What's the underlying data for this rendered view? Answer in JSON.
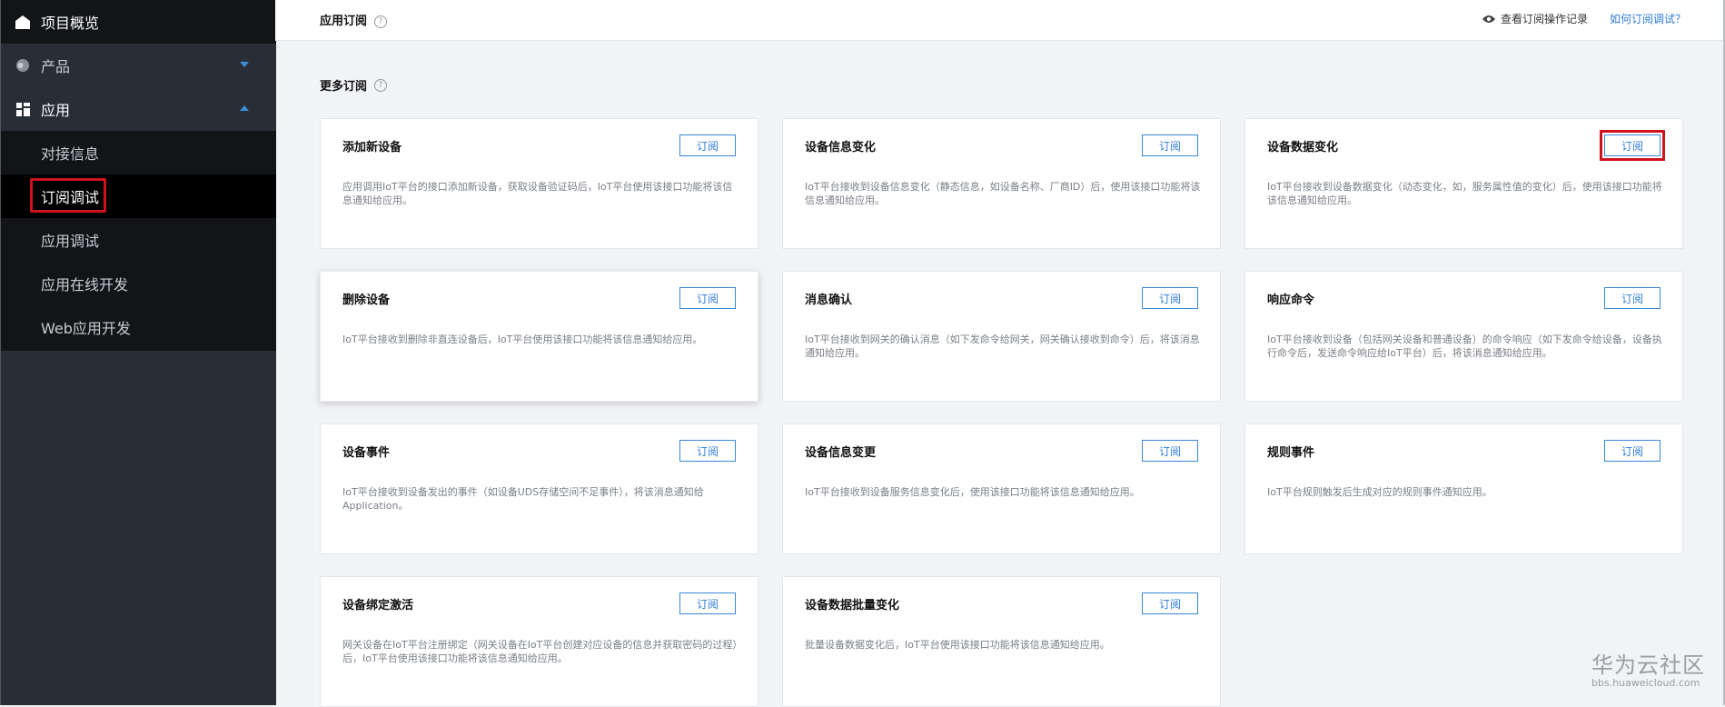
{
  "sidebar": {
    "overview": "项目概览",
    "product": "产品",
    "application": "应用",
    "app_sub_items": [
      "对接信息",
      "订阅调试",
      "应用调试",
      "应用在线开发",
      "Web应用开发"
    ]
  },
  "header": {
    "title": "应用订阅",
    "records_link": "查看订阅操作记录",
    "howto_link": "如何订阅调试？"
  },
  "section_title": "更多订阅",
  "subscribe_label": "订阅",
  "cards": [
    {
      "title": "添加新设备",
      "desc": "应用调用IoT平台的接口添加新设备，获取设备验证码后，IoT平台使用该接口功能将该信息通知给应用。"
    },
    {
      "title": "设备信息变化",
      "desc": "IoT平台接收到设备信息变化（静态信息，如设备名称、厂商ID）后，使用该接口功能将该信息通知给应用。"
    },
    {
      "title": "设备数据变化",
      "desc": "IoT平台接收到设备数据变化（动态变化，如，服务属性值的变化）后，使用该接口功能将该信息通知给应用。"
    },
    {
      "title": "删除设备",
      "desc": "IoT平台接收到删除非直连设备后，IoT平台使用该接口功能将该信息通知给应用。"
    },
    {
      "title": "消息确认",
      "desc": "IoT平台接收到网关的确认消息（如下发命令给网关，网关确认接收到命令）后，将该消息通知给应用。"
    },
    {
      "title": "响应命令",
      "desc": "IoT平台接收到设备（包括网关设备和普通设备）的命令响应（如下发命令给设备，设备执行命令后，发送命令响应给IoT平台）后，将该消息通知给应用。"
    },
    {
      "title": "设备事件",
      "desc": "IoT平台接收到设备发出的事件（如设备UDS存储空间不足事件），将该消息通知给Application。"
    },
    {
      "title": "设备信息变更",
      "desc": "IoT平台接收到设备服务信息变化后，使用该接口功能将该信息通知给应用。"
    },
    {
      "title": "规则事件",
      "desc": "IoT平台规则触发后生成对应的规则事件通知应用。"
    },
    {
      "title": "设备绑定激活",
      "desc": "网关设备在IoT平台注册绑定（网关设备在IoT平台创建对应设备的信息并获取密码的过程）后，IoT平台使用该接口功能将该信息通知给应用。"
    },
    {
      "title": "设备数据批量变化",
      "desc": "批量设备数据变化后，IoT平台使用该接口功能将该信息通知给应用。"
    }
  ],
  "watermark": {
    "line1": "华为云社区",
    "line2": "bbs.huaweicloud.com"
  },
  "colors": {
    "accent": "#2f7bd8",
    "highlight": "#d0121a",
    "sidebar": "#282d36"
  }
}
